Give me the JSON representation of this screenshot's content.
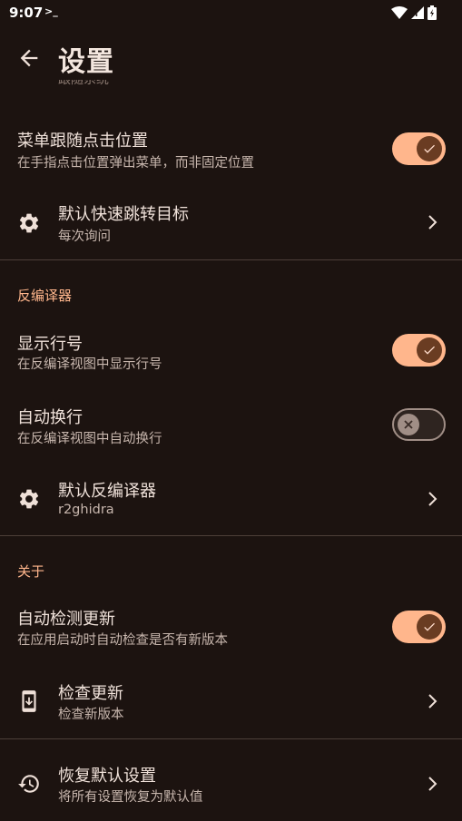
{
  "status_bar": {
    "time": "9:07",
    "terminal_glyph": ">_"
  },
  "app_bar": {
    "title": "设置"
  },
  "cut_row": {
    "text": "跟随系统"
  },
  "rows": {
    "menu_follow": {
      "title": "菜单跟随点击位置",
      "subtitle": "在手指点击位置弹出菜单，而非固定位置",
      "toggle": true
    },
    "default_jump": {
      "title": "默认快速跳转目标",
      "subtitle": "每次询问",
      "icon": "gear-icon"
    },
    "show_line_numbers": {
      "title": "显示行号",
      "subtitle": "在反编译视图中显示行号",
      "toggle": true
    },
    "auto_wrap": {
      "title": "自动换行",
      "subtitle": "在反编译视图中自动换行",
      "toggle": false
    },
    "default_decompiler": {
      "title": "默认反编译器",
      "subtitle": "r2ghidra",
      "icon": "gear-icon"
    },
    "auto_check_update": {
      "title": "自动检测更新",
      "subtitle": "在应用启动时自动检查是否有新版本",
      "toggle": true
    },
    "check_update": {
      "title": "检查更新",
      "subtitle": "检查新版本",
      "icon": "download-icon"
    },
    "restore_defaults": {
      "title": "恢复默认设置",
      "subtitle": "将所有设置恢复为默认值",
      "icon": "history-icon"
    }
  },
  "sections": {
    "decompiler": "反编译器",
    "about": "关于"
  },
  "colors": {
    "background": "#1c1310",
    "accent": "#ffb68c",
    "toggle_knob": "#6a3c22",
    "divider": "#4d3f39"
  }
}
